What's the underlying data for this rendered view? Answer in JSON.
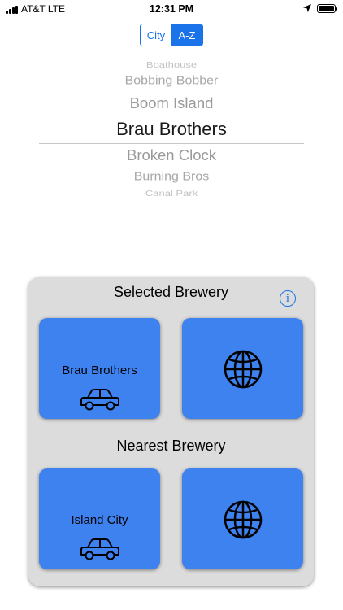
{
  "status_bar": {
    "carrier": "AT&T  LTE",
    "time": "12:31 PM"
  },
  "segmented": {
    "options": [
      "City",
      "A-Z"
    ],
    "selected": "A-Z"
  },
  "picker": {
    "items": [
      "Boathouse",
      "Bobbing Bobber",
      "Boom Island",
      "Brau Brothers",
      "Broken Clock",
      "Burning Bros",
      "Canal Park"
    ],
    "selected": "Brau Brothers"
  },
  "selected_section": {
    "title": "Selected Brewery",
    "name": "Brau Brothers",
    "icons": [
      "car-icon",
      "globe-icon"
    ]
  },
  "nearest_section": {
    "title": "Nearest Brewery",
    "name": "Island City",
    "icons": [
      "car-icon",
      "globe-icon"
    ]
  },
  "info_button": {
    "label": "i"
  },
  "colors": {
    "accent": "#1a73e8",
    "tile": "#3e82f0",
    "panel": "#dcdcdc"
  }
}
